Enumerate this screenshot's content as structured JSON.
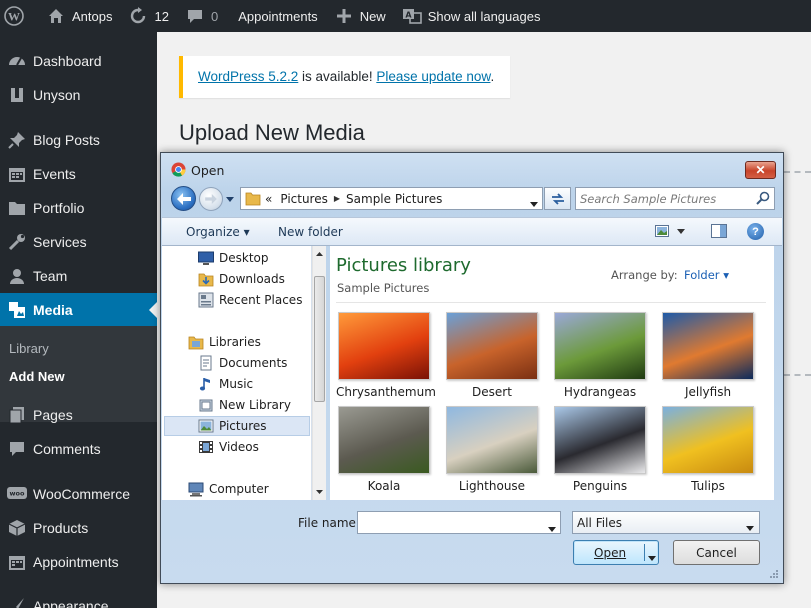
{
  "adminbar": {
    "site_name": "Antops",
    "updates_count": "12",
    "comments_count": "0",
    "appointments_label": "Appointments",
    "new_label": "New",
    "languages_label": "Show all languages"
  },
  "sidebar": {
    "items": [
      {
        "label": "Dashboard",
        "icon": "dashboard-icon"
      },
      {
        "label": "Unyson",
        "icon": "unyson-icon"
      },
      {
        "label": "Blog Posts",
        "icon": "pin-icon"
      },
      {
        "label": "Events",
        "icon": "calendar-icon"
      },
      {
        "label": "Portfolio",
        "icon": "folder-icon"
      },
      {
        "label": "Services",
        "icon": "wrench-icon"
      },
      {
        "label": "Team",
        "icon": "user-icon"
      },
      {
        "label": "Media",
        "icon": "media-icon"
      },
      {
        "label": "Pages",
        "icon": "pages-icon"
      },
      {
        "label": "Comments",
        "icon": "comment-icon"
      },
      {
        "label": "WooCommerce",
        "icon": "woo-icon"
      },
      {
        "label": "Products",
        "icon": "box-icon"
      },
      {
        "label": "Appointments",
        "icon": "calendar-icon"
      },
      {
        "label": "Appearance",
        "icon": "brush-icon"
      }
    ],
    "submenu": {
      "library": "Library",
      "add_new": "Add New"
    }
  },
  "notice": {
    "version_link": "WordPress 5.2.2",
    "middle_text": " is available! ",
    "update_link": "Please update now",
    "end_text": "."
  },
  "page_title": "Upload New Media",
  "dialog": {
    "title": "Open",
    "close_label": "✕",
    "address": {
      "prefix": "«",
      "crumbs": [
        "Pictures",
        "Sample Pictures"
      ]
    },
    "search_placeholder": "Search Sample Pictures",
    "toolbar": {
      "organize": "Organize ▾",
      "new_folder": "New folder",
      "help": "?"
    },
    "nav_tree": [
      {
        "label": "Desktop",
        "icon": "desktop-icon"
      },
      {
        "label": "Downloads",
        "icon": "downloads-icon"
      },
      {
        "label": "Recent Places",
        "icon": "recent-places-icon"
      },
      {
        "label": "Libraries",
        "icon": "libraries-icon"
      },
      {
        "label": "Documents",
        "icon": "documents-icon"
      },
      {
        "label": "Music",
        "icon": "music-icon"
      },
      {
        "label": "New Library",
        "icon": "library-icon"
      },
      {
        "label": "Pictures",
        "icon": "pictures-icon"
      },
      {
        "label": "Videos",
        "icon": "videos-icon"
      },
      {
        "label": "Computer",
        "icon": "computer-icon"
      }
    ],
    "library_title": "Pictures library",
    "library_subtitle": "Sample Pictures",
    "arrange_label": "Arrange by:",
    "arrange_value": "Folder ▾",
    "files": [
      {
        "name": "Chrysanthemum",
        "colors": [
          "#ff9a3a",
          "#e2400f",
          "#7a1206"
        ]
      },
      {
        "name": "Desert",
        "colors": [
          "#6aa0d8",
          "#c8632b",
          "#7a2f12"
        ]
      },
      {
        "name": "Hydrangeas",
        "colors": [
          "#9aa8d8",
          "#6c9a3a",
          "#1f3a12"
        ]
      },
      {
        "name": "Jellyfish",
        "colors": [
          "#1e5aa8",
          "#e07a30",
          "#0b2a5c"
        ]
      },
      {
        "name": "Koala",
        "colors": [
          "#9a9a92",
          "#5c5a50",
          "#3a5a20"
        ]
      },
      {
        "name": "Lighthouse",
        "colors": [
          "#8fb8e0",
          "#d8d0c0",
          "#4a5a3a"
        ]
      },
      {
        "name": "Penguins",
        "colors": [
          "#aac8e8",
          "#2a2a30",
          "#e8e8ea"
        ]
      },
      {
        "name": "Tulips",
        "colors": [
          "#7ab0e0",
          "#f0c020",
          "#c88a10"
        ]
      }
    ],
    "file_name_label": "File name:",
    "file_name_value": "",
    "file_type": "All Files",
    "open_label": "Open",
    "cancel_label": "Cancel"
  },
  "colors": {
    "wp_dark": "#23282d",
    "wp_blue": "#0073aa",
    "notice_yellow": "#ffb900",
    "library_green": "#1e6a2e"
  }
}
